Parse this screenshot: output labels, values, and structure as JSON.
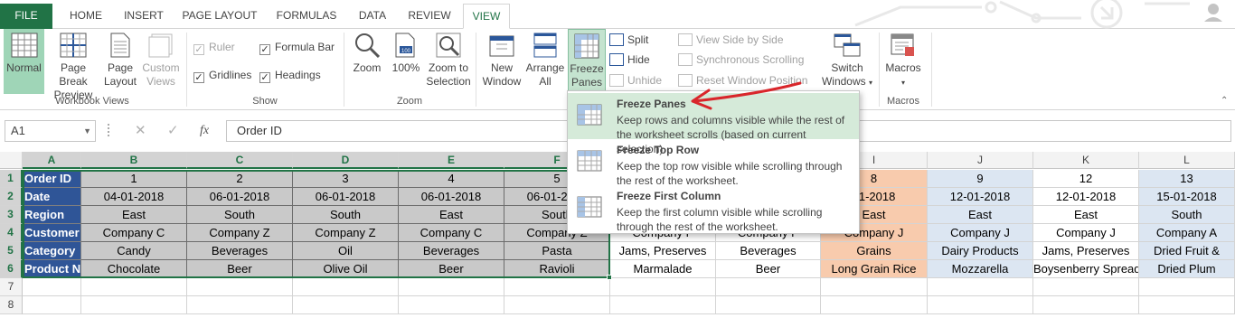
{
  "tabs": [
    "FILE",
    "HOME",
    "INSERT",
    "PAGE LAYOUT",
    "FORMULAS",
    "DATA",
    "REVIEW",
    "VIEW"
  ],
  "ribbon": {
    "workbook_views": {
      "label": "Workbook Views",
      "normal": "Normal",
      "page_break_1": "Page Break",
      "page_break_2": "Preview",
      "page_layout_1": "Page",
      "page_layout_2": "Layout",
      "custom_1": "Custom",
      "custom_2": "Views"
    },
    "show": {
      "label": "Show",
      "ruler": "Ruler",
      "formula_bar": "Formula Bar",
      "gridlines": "Gridlines",
      "headings": "Headings"
    },
    "zoom": {
      "label": "Zoom",
      "zoom": "Zoom",
      "hundred": "100%",
      "zoom_sel_1": "Zoom to",
      "zoom_sel_2": "Selection"
    },
    "window": {
      "new_1": "New",
      "new_2": "Window",
      "arrange_1": "Arrange",
      "arrange_2": "All",
      "freeze_1": "Freeze",
      "freeze_2": "Panes",
      "split": "Split",
      "hide": "Hide",
      "unhide": "Unhide",
      "side_by_side": "View Side by Side",
      "sync_scroll": "Synchronous Scrolling",
      "reset_pos": "Reset Window Position",
      "switch_1": "Switch",
      "switch_2": "Windows"
    },
    "macros": {
      "label": "Macros",
      "macros": "Macros"
    }
  },
  "formula_bar": {
    "name_box": "A1",
    "cancel": "✕",
    "enter": "✓",
    "fx": "fx",
    "value": "Order ID"
  },
  "columns": [
    "A",
    "B",
    "C",
    "D",
    "E",
    "F",
    "I",
    "J",
    "K",
    "L"
  ],
  "rows": [
    "1",
    "2",
    "3",
    "4",
    "5",
    "6",
    "7",
    "8"
  ],
  "sheet": {
    "row_labels": [
      "Order ID",
      "Date",
      "Region",
      "Customer",
      "Category",
      "Product N"
    ],
    "left_block": [
      [
        "1",
        "2",
        "3",
        "4",
        "5"
      ],
      [
        "04-01-2018",
        "06-01-2018",
        "06-01-2018",
        "06-01-2018",
        "06-01-2018"
      ],
      [
        "East",
        "South",
        "South",
        "East",
        "South"
      ],
      [
        "Company C",
        "Company Z",
        "Company Z",
        "Company C",
        "Company Z"
      ],
      [
        "Candy",
        "Beverages",
        "Oil",
        "Beverages",
        "Pasta"
      ],
      [
        "Chocolate",
        "Beer",
        "Olive Oil",
        "Beer",
        "Ravioli"
      ]
    ],
    "g_col": [
      "",
      "",
      "",
      "Company F",
      "Jams, Preserves",
      "Marmalade"
    ],
    "h_col": [
      "",
      "",
      "",
      "Company F",
      "Beverages",
      "Beer"
    ],
    "i_col": [
      "8",
      "01-2018",
      "East",
      "Company J",
      "Grains",
      "Long Grain Rice"
    ],
    "j_col": [
      "9",
      "12-01-2018",
      "East",
      "Company J",
      "Dairy Products",
      "Mozzarella"
    ],
    "k_col": [
      "12",
      "12-01-2018",
      "East",
      "Company J",
      "Jams, Preserves",
      "Boysenberry Spread"
    ],
    "l_col": [
      "13",
      "15-01-2018",
      "South",
      "Company A",
      "Dried Fruit &",
      "Dried Plum"
    ]
  },
  "freeze_menu": {
    "item1_title": "Freeze Panes",
    "item1_desc": "Keep rows and columns visible while the rest of the worksheet scrolls (based on current selection).",
    "item2_title": "Freeze Top Row",
    "item2_desc": "Keep the top row visible while scrolling through the rest of the worksheet.",
    "item3_title": "Freeze First Column",
    "item3_desc": "Keep the first column visible while scrolling through the rest of the worksheet."
  },
  "colors": {
    "excel_green": "#217346",
    "header_blue": "#2f5597",
    "gray_fill": "#c9c9c9",
    "peach_fill": "#f8cbad",
    "light_blue_fill": "#dce6f2",
    "annotation_red": "#d9262b"
  }
}
